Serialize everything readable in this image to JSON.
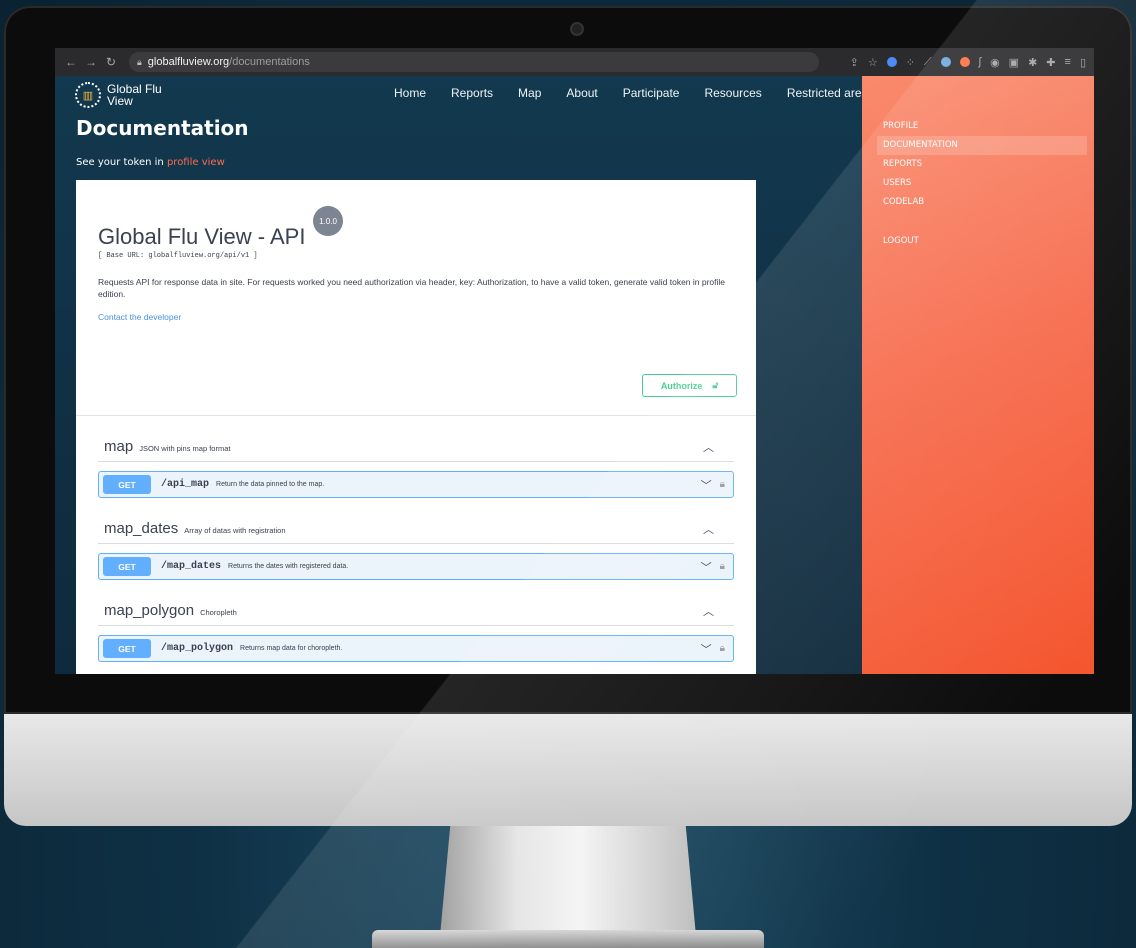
{
  "browser": {
    "url_host": "globalfluview.org",
    "url_path": "/documentations"
  },
  "site": {
    "logo_line1": "Global Flu",
    "logo_line2": "View",
    "nav": [
      "Home",
      "Reports",
      "Map",
      "About",
      "Participate",
      "Resources",
      "Restricted area"
    ],
    "page_title": "Documentation",
    "token_prefix": "See your token in",
    "token_link": "profile view"
  },
  "api": {
    "title": "Global Flu View - API",
    "version": "1.0.0",
    "base_url": "[ Base URL: globalfluview.org/api/v1 ]",
    "description": "Requests API for response data in site. For requests worked you need authorization via header, key: Authorization, to have a valid token, generate valid token in profile edition.",
    "contact": "Contact the developer",
    "authorize": "Authorize",
    "sections": [
      {
        "name": "map",
        "description": "JSON with pins map format",
        "method": "GET",
        "path": "/api_map",
        "summary": "Return the data pinned to the map."
      },
      {
        "name": "map_dates",
        "description": "Array of datas with registration",
        "method": "GET",
        "path": "/map_dates",
        "summary": "Returns the dates with registered data."
      },
      {
        "name": "map_polygon",
        "description": "Choropleth",
        "method": "GET",
        "path": "/map_polygon",
        "summary": "Returns map data for choropleth."
      }
    ]
  },
  "sidebar": {
    "items": [
      "PROFILE",
      "DOCUMENTATION",
      "REPORTS",
      "USERS",
      "CODELAB"
    ],
    "active": "DOCUMENTATION",
    "logout": "LOGOUT"
  },
  "colors": {
    "accent_orange": "#f76c4e",
    "get_blue": "#61affe",
    "authorize_green": "#49cc90",
    "page_bg": "#123447"
  },
  "icons": [
    "back-arrow-icon",
    "forward-arrow-icon",
    "reload-icon",
    "lock-icon",
    "share-icon",
    "star-icon",
    "extension-icon",
    "chevron-up-icon",
    "chevron-down-icon",
    "padlock-icon"
  ]
}
